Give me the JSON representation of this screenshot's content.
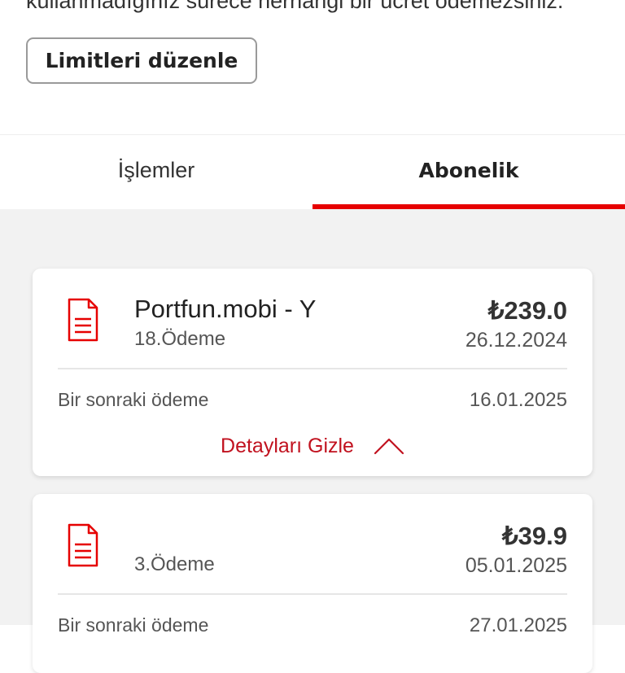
{
  "header": {
    "info_text": "kullanmadığınız sürece herhangi bir ücret ödemezsiniz.",
    "edit_limits_label": "Limitleri düzenle"
  },
  "tabs": [
    {
      "label": "İşlemler",
      "active": false
    },
    {
      "label": "Abonelik",
      "active": true
    }
  ],
  "subscriptions": [
    {
      "icon": "document-icon",
      "title": "Portfun.mobi - Y",
      "payment_count": "18.Ödeme",
      "amount": "₺239.0",
      "date": "26.12.2024",
      "next_label": "Bir sonraki ödeme",
      "next_date": "16.01.2025",
      "toggle_label": "Detayları Gizle"
    },
    {
      "icon": "document-icon",
      "title": "",
      "payment_count": "3.Ödeme",
      "amount": "₺39.9",
      "date": "05.01.2025",
      "next_label": "Bir sonraki ödeme",
      "next_date": "27.01.2025"
    }
  ],
  "colors": {
    "accent": "#e60000",
    "link": "#c1121f",
    "background": "#f2f2f2"
  }
}
